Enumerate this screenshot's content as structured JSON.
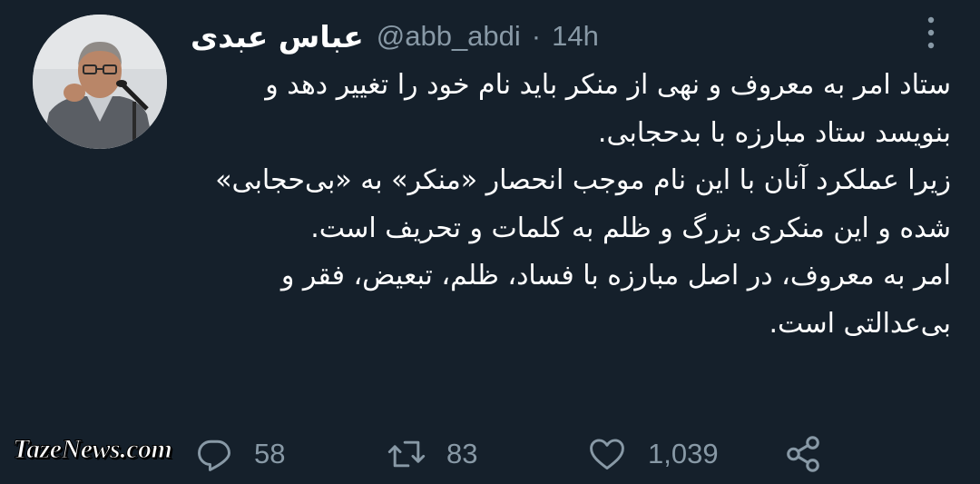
{
  "tweet": {
    "author": {
      "display_name": "عباس عبدی",
      "handle": "@abb_abdi"
    },
    "separator": "·",
    "timestamp": "14h",
    "paragraphs": [
      "ستاد امر به معروف و نهی از منکر باید نام خود را تغییر دهد و بنویسد ستاد مبارزه با بدحجابی.",
      "زیرا عملکرد آنان با این نام موجب انحصار «منکر» به «بی‌حجابی» شده و این منکری بزرگ و ظلم به کلمات و تحریف است.",
      "امر به معروف، در اصل مبارزه با فساد، ظلم، تبعیض، فقر و بی‌عدالتی است."
    ]
  },
  "actions": {
    "reply": {
      "icon": "reply-icon",
      "count": "58"
    },
    "retweet": {
      "icon": "retweet-icon",
      "count": "83"
    },
    "like": {
      "icon": "heart-icon",
      "count": "1,039"
    },
    "share": {
      "icon": "share-icon"
    }
  },
  "watermark": "TazeNews.com",
  "colors": {
    "background": "#15202b",
    "text_primary": "#ffffff",
    "text_secondary": "#8899a6"
  }
}
